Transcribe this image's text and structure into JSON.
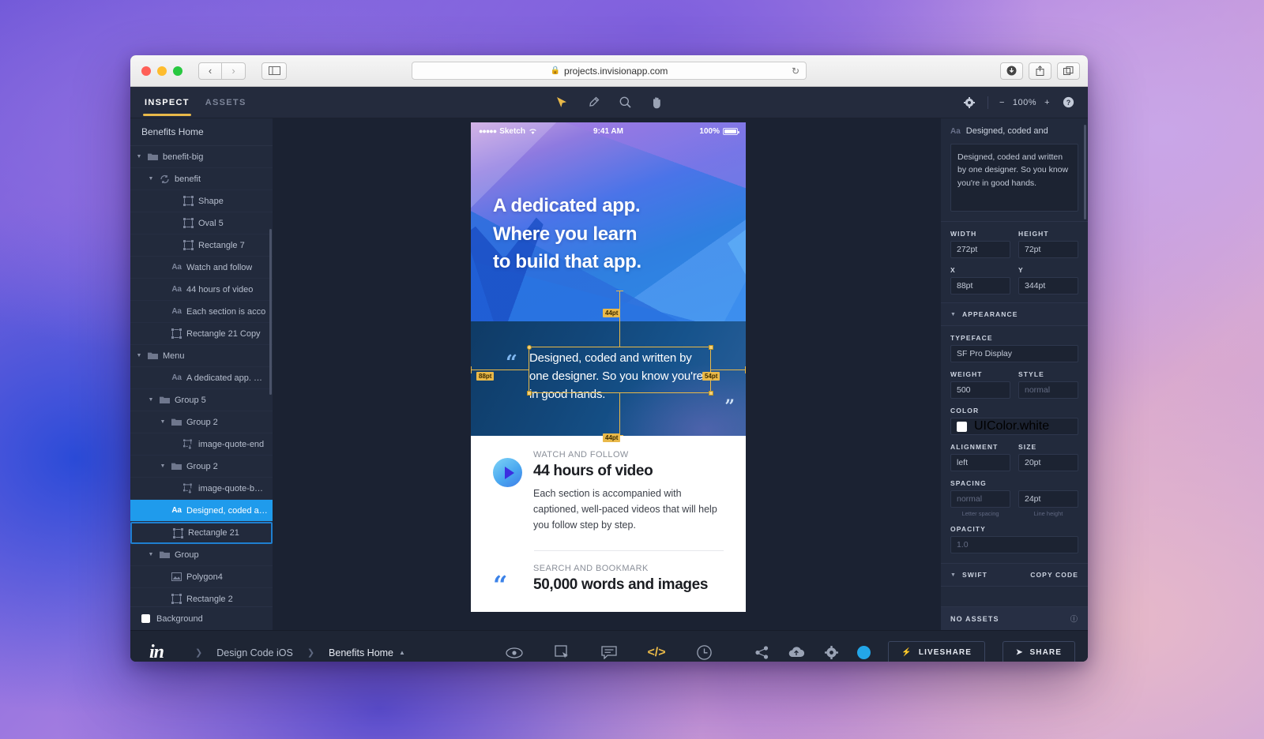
{
  "browser": {
    "url": "projects.invisionapp.com",
    "lock_icon": "lock-icon",
    "back_icon": "chevron-left-icon",
    "forward_icon": "chevron-right-icon",
    "sidebar_icon": "sidebar-toggle-icon",
    "reload_icon": "reload-icon",
    "download_icon": "download-icon",
    "share_icon": "share-icon",
    "tabs_icon": "tabs-icon",
    "newtab_icon": "plus-icon"
  },
  "topbar": {
    "tabs": [
      {
        "label": "INSPECT",
        "active": true
      },
      {
        "label": "ASSETS",
        "active": false
      }
    ],
    "tools": [
      {
        "name": "cursor-tool",
        "glyph": "➤",
        "active": true
      },
      {
        "name": "eyedropper-tool",
        "glyph": "✐",
        "active": false
      },
      {
        "name": "magnifier-tool",
        "glyph": "⌕",
        "active": false
      },
      {
        "name": "hand-tool",
        "glyph": "✋",
        "active": false
      }
    ],
    "settings_icon": "gear-icon",
    "zoom_out": "−",
    "zoom_level": "100%",
    "zoom_in": "+",
    "help_icon": "help-icon"
  },
  "sidebar": {
    "title": "Benefits Home",
    "layers": [
      {
        "label": "benefit-big",
        "indent": 1,
        "icon": "folder",
        "arrow": true,
        "selected": false,
        "outlined": false
      },
      {
        "label": "benefit",
        "indent": 2,
        "icon": "symbol",
        "arrow": true,
        "selected": false,
        "outlined": false
      },
      {
        "label": "Shape",
        "indent": 4,
        "icon": "shape",
        "arrow": false,
        "selected": false,
        "outlined": false
      },
      {
        "label": "Oval 5",
        "indent": 4,
        "icon": "shape",
        "arrow": false,
        "selected": false,
        "outlined": false
      },
      {
        "label": "Rectangle 7",
        "indent": 4,
        "icon": "shape",
        "arrow": false,
        "selected": false,
        "outlined": false
      },
      {
        "label": "Watch and follow",
        "indent": 3,
        "icon": "text",
        "arrow": false,
        "selected": false,
        "outlined": false
      },
      {
        "label": "44 hours of video",
        "indent": 3,
        "icon": "text",
        "arrow": false,
        "selected": false,
        "outlined": false
      },
      {
        "label": "Each section is acco",
        "indent": 3,
        "icon": "text",
        "arrow": false,
        "selected": false,
        "outlined": false
      },
      {
        "label": "Rectangle 21 Copy",
        "indent": 3,
        "icon": "shape",
        "arrow": false,
        "selected": false,
        "outlined": false
      },
      {
        "label": "Menu",
        "indent": 1,
        "icon": "folder",
        "arrow": true,
        "selected": false,
        "outlined": false
      },
      {
        "label": "A dedicated app. Whe",
        "indent": 3,
        "icon": "text",
        "arrow": false,
        "selected": false,
        "outlined": false
      },
      {
        "label": "Group 5",
        "indent": 2,
        "icon": "folder",
        "arrow": true,
        "selected": false,
        "outlined": false
      },
      {
        "label": "Group 2",
        "indent": 3,
        "icon": "folder",
        "arrow": true,
        "selected": false,
        "outlined": false
      },
      {
        "label": "image-quote-end",
        "indent": 4,
        "icon": "image-exp",
        "arrow": false,
        "selected": false,
        "outlined": false
      },
      {
        "label": "Group 2",
        "indent": 3,
        "icon": "folder",
        "arrow": true,
        "selected": false,
        "outlined": false
      },
      {
        "label": "image-quote-beg...",
        "indent": 4,
        "icon": "image-exp",
        "arrow": false,
        "selected": false,
        "outlined": false
      },
      {
        "label": "Designed, coded and",
        "indent": 3,
        "icon": "text",
        "arrow": false,
        "selected": true,
        "outlined": false
      },
      {
        "label": "Rectangle 21",
        "indent": 3,
        "icon": "shape",
        "arrow": false,
        "selected": false,
        "outlined": true
      },
      {
        "label": "Group",
        "indent": 2,
        "icon": "folder",
        "arrow": true,
        "selected": false,
        "outlined": false
      },
      {
        "label": "Polygon4",
        "indent": 3,
        "icon": "picture",
        "arrow": false,
        "selected": false,
        "outlined": false
      },
      {
        "label": "Rectangle 2",
        "indent": 3,
        "icon": "shape",
        "arrow": false,
        "selected": false,
        "outlined": false
      }
    ],
    "background_label": "Background"
  },
  "canvas": {
    "status_bar": {
      "carrier_dots": "●●●●●",
      "carrier": "Sketch",
      "wifi_icon": "wifi-icon",
      "time": "9:41 AM",
      "battery_pct": "100%"
    },
    "hero_lines": [
      "A dedicated app.",
      "Where you learn",
      "to build that app."
    ],
    "quote": "Designed, coded and written by one designer. So you know you're in good hands.",
    "measurements": {
      "top": "44pt",
      "left": "88pt",
      "right": "54pt",
      "bottom": "44pt",
      "below": "44pt"
    },
    "card1": {
      "kicker": "WATCH AND FOLLOW",
      "title": "44 hours of video",
      "body": "Each section is accompanied with captioned, well-paced videos that will help you follow step by step.",
      "icon": "play-icon"
    },
    "card2": {
      "kicker": "SEARCH AND BOOKMARK",
      "title": "50,000 words and images",
      "icon": "quote-icon"
    }
  },
  "inspector": {
    "layer_name": "Designed, coded and",
    "layer_icon": "text-icon",
    "content": "Designed, coded and written by one designer. So you know you're in good hands.",
    "width_label": "WIDTH",
    "width_value": "272pt",
    "height_label": "HEIGHT",
    "height_value": "72pt",
    "x_label": "X",
    "x_value": "88pt",
    "y_label": "Y",
    "y_value": "344pt",
    "appearance_title": "APPEARANCE",
    "typeface_label": "TYPEFACE",
    "typeface_value": "SF Pro Display",
    "weight_label": "WEIGHT",
    "weight_value": "500",
    "style_label": "STYLE",
    "style_value": "normal",
    "color_label": "COLOR",
    "color_value": "UIColor.white",
    "color_hex": "#ffffff",
    "alignment_label": "ALIGNMENT",
    "alignment_value": "left",
    "size_label": "SIZE",
    "size_value": "20pt",
    "spacing_label": "SPACING",
    "letter_spacing_value": "normal",
    "letter_spacing_sub": "Letter spacing",
    "line_height_value": "24pt",
    "line_height_sub": "Line height",
    "opacity_label": "OPACITY",
    "opacity_value": "1.0",
    "swift_title": "SWIFT",
    "copy_code_label": "COPY CODE",
    "no_assets_label": "NO ASSETS"
  },
  "footer": {
    "logo": "in",
    "breadcrumbs": [
      "Design Code iOS",
      "Benefits Home"
    ],
    "center_icons": [
      {
        "name": "preview-eye-icon",
        "glyph": "◉",
        "active": false
      },
      {
        "name": "inspect-icon",
        "glyph": "⬚",
        "active": false
      },
      {
        "name": "comment-icon",
        "glyph": "⌸",
        "active": false
      },
      {
        "name": "code-icon",
        "glyph": "</>",
        "active": true
      },
      {
        "name": "history-icon",
        "glyph": "◷",
        "active": false
      }
    ],
    "right_icons": [
      {
        "name": "share-nodes-icon",
        "glyph": "⚭"
      },
      {
        "name": "cloud-icon",
        "glyph": "☁"
      },
      {
        "name": "gear-icon",
        "glyph": "⚙"
      }
    ],
    "liveshare_label": "LIVESHARE",
    "liveshare_icon": "bolt-icon",
    "share_label": "SHARE",
    "share_icon": "paper-plane-icon"
  },
  "colors": {
    "accent_yellow": "#e9b949",
    "selection_blue": "#1f9bec",
    "panel_bg": "#222a3c",
    "canvas_bg": "#1b2232"
  }
}
